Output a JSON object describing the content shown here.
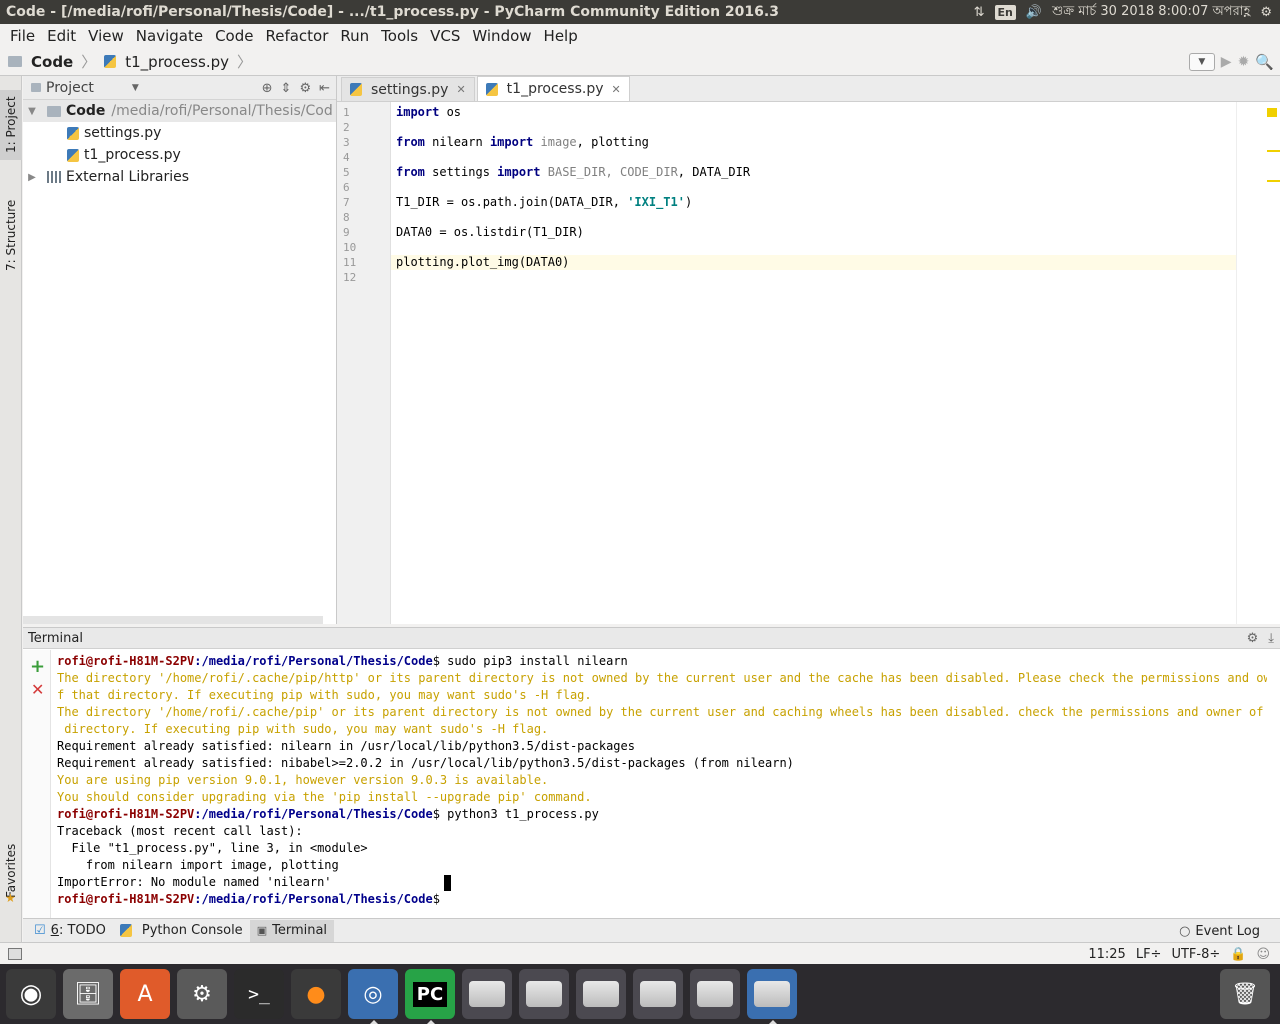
{
  "window": {
    "title": "Code - [/media/rofi/Personal/Thesis/Code] - .../t1_process.py - PyCharm Community Edition 2016.3"
  },
  "system_tray": {
    "lang": "En",
    "datetime": "শুক্র মার্চ 30 2018 8:00:07 অপরাহ্ণ"
  },
  "menu": [
    "File",
    "Edit",
    "View",
    "Navigate",
    "Code",
    "Refactor",
    "Run",
    "Tools",
    "VCS",
    "Window",
    "Help"
  ],
  "navbar": {
    "root": "Code",
    "file": "t1_process.py"
  },
  "side_tabs": {
    "project": "1: Project",
    "structure": "7: Structure",
    "favorites": "Favorites"
  },
  "project_panel": {
    "title": "Project",
    "root_name": "Code",
    "root_path": "/media/rofi/Personal/Thesis/Cod",
    "files": [
      "settings.py",
      "t1_process.py"
    ],
    "external": "External Libraries"
  },
  "editor": {
    "tabs": [
      "settings.py",
      "t1_process.py"
    ],
    "active_tab": "t1_process.py",
    "line_numbers": [
      "1",
      "2",
      "3",
      "4",
      "5",
      "6",
      "7",
      "8",
      "9",
      "10",
      "11",
      "12"
    ],
    "lines": {
      "l1_kw": "import",
      "l1_rest": " os",
      "l3_a": "from",
      "l3_b": " nilearn ",
      "l3_c": "import",
      "l3_d": " image",
      "l3_e": ", plotting",
      "l5_a": "from",
      "l5_b": " settings ",
      "l5_c": "import",
      "l5_d": " BASE_DIR",
      "l5_e": ", ",
      "l5_f": "CODE_DIR",
      "l5_g": ", DATA_DIR",
      "l7_a": "T1_DIR = os.path.join(DATA_DIR, ",
      "l7_b": "'IXI_T1'",
      "l7_c": ")",
      "l9": "DATA0 = os.listdir(T1_DIR)",
      "l11": "plotting.plot_img(DATA0)"
    }
  },
  "terminal": {
    "title": "Terminal",
    "prompt_user": "rofi@rofi-H81M-S2PV",
    "prompt_path": ":/media/rofi/Personal/Thesis/Code",
    "cmd1": "$ sudo pip3 install nilearn",
    "w1": "The directory '/home/rofi/.cache/pip/http' or its parent directory is not owned by the current user and the cache has been disabled. Please check the permissions and owner o",
    "w2": "f that directory. If executing pip with sudo, you may want sudo's -H flag.",
    "w3": "The directory '/home/rofi/.cache/pip' or its parent directory is not owned by the current user and caching wheels has been disabled. check the permissions and owner of that",
    "w4": " directory. If executing pip with sudo, you may want sudo's -H flag.",
    "r1": "Requirement already satisfied: nilearn in /usr/local/lib/python3.5/dist-packages",
    "r2": "Requirement already satisfied: nibabel>=2.0.2 in /usr/local/lib/python3.5/dist-packages (from nilearn)",
    "w5": "You are using pip version 9.0.1, however version 9.0.3 is available.",
    "w6": "You should consider upgrading via the 'pip install --upgrade pip' command.",
    "cmd2": "$ python3 t1_process.py",
    "t1": "Traceback (most recent call last):",
    "t2": "  File \"t1_process.py\", line 3, in <module>",
    "t3": "    from nilearn import image, plotting",
    "t4": "ImportError: No module named 'nilearn'",
    "cmd3": "$"
  },
  "tool_tabs": {
    "todo_num": "6",
    "todo": ": TODO",
    "python_console": "Python Console",
    "terminal": "Terminal",
    "event_log": "Event Log"
  },
  "status": {
    "position": "11:25",
    "line_sep": "LF÷",
    "encoding": "UTF-8÷"
  }
}
